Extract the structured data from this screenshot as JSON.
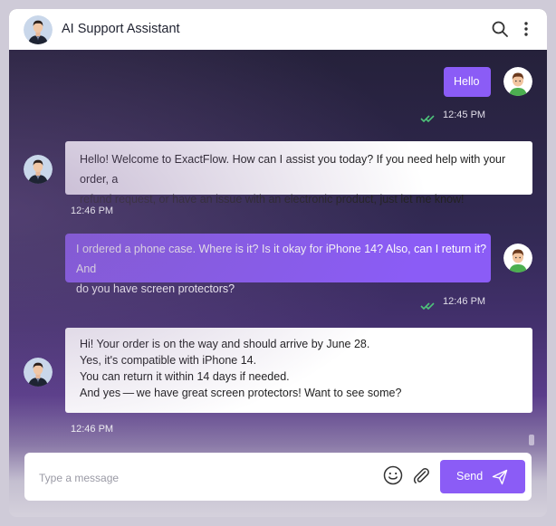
{
  "header": {
    "title": "AI Support Assistant",
    "icons": [
      "bot-avatar",
      "search-icon",
      "more-vert-icon"
    ]
  },
  "messages": [
    {
      "sender": "user",
      "lines": [
        "Hello"
      ],
      "time": "12:45 PM",
      "read": true
    },
    {
      "sender": "bot",
      "lines": [
        "Hello! Welcome to ExactFlow. How can I assist you today? If you need help with your order, a",
        "refund request, or have an issue with an electronic product, just let me know!"
      ],
      "time": "12:46 PM"
    },
    {
      "sender": "user",
      "lines": [
        "I ordered a phone case. Where is it? Is it okay for iPhone 14? Also, can I return it? And",
        "do you have screen protectors?"
      ],
      "time": "12:46 PM",
      "read": true
    },
    {
      "sender": "bot",
      "lines": [
        "Hi! Your order is on the way and should arrive by June 28.",
        "Yes, it's compatible with iPhone 14.",
        "You can return it within 14 days if needed.",
        "And yes — we have great screen protectors! Want to see some?"
      ],
      "time": "12:46 PM"
    }
  ],
  "composer": {
    "placeholder": "Type a message",
    "send_label": "Send",
    "icons": [
      "emoji-icon",
      "attach-icon",
      "send-icon"
    ]
  },
  "colors": {
    "accent": "#8b5cf6",
    "bubble_bot": "#ffffff",
    "read_check": "#4ec27a"
  }
}
